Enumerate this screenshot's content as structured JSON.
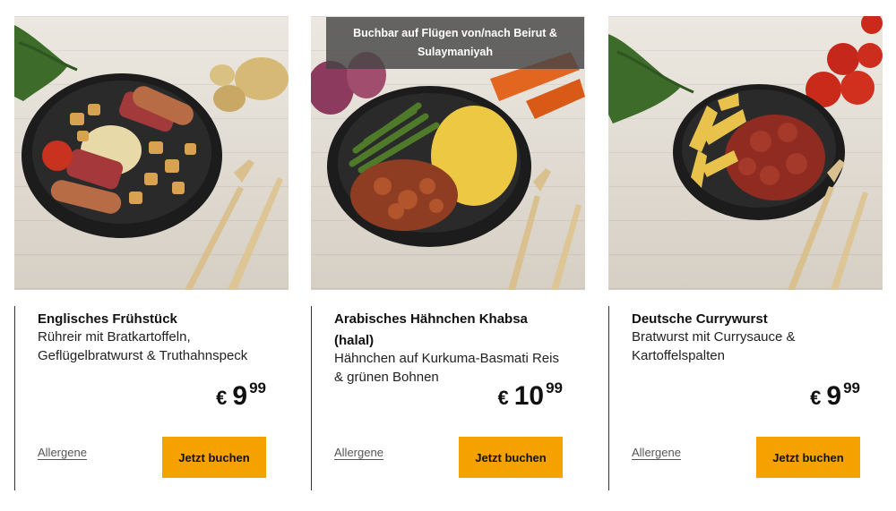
{
  "cards": [
    {
      "image_name": "english-breakfast-dish",
      "title": "Englisches Frühstück",
      "description": "Rühreir mit Bratkartoffeln, Geflügelbratwurst & Truthahnspeck",
      "price": {
        "currency": "€",
        "main": "9",
        "cents": "99"
      },
      "allergen_label": "Allergene",
      "button_label": "Jetzt buchen"
    },
    {
      "image_name": "arabic-chicken-khabsa-dish",
      "badge": "Buchbar auf Flügen von/nach Beirut & Sulaymaniyah",
      "title": "Arabisches Hähnchen Khabsa (halal)",
      "description": "Hähnchen auf Kurkuma-Basmati Reis & grünen Bohnen",
      "price": {
        "currency": "€",
        "main": "10",
        "cents": "99"
      },
      "allergen_label": "Allergene",
      "button_label": "Jetzt buchen"
    },
    {
      "image_name": "currywurst-dish",
      "title": "Deutsche Currywurst",
      "description": "Bratwurst mit Currysauce & Kartoffelspalten",
      "price": {
        "currency": "€",
        "main": "9",
        "cents": "99"
      },
      "allergen_label": "Allergene",
      "button_label": "Jetzt buchen"
    }
  ],
  "colors": {
    "button": "#f5a200",
    "badge_bg": "#464646",
    "text": "#111111"
  }
}
